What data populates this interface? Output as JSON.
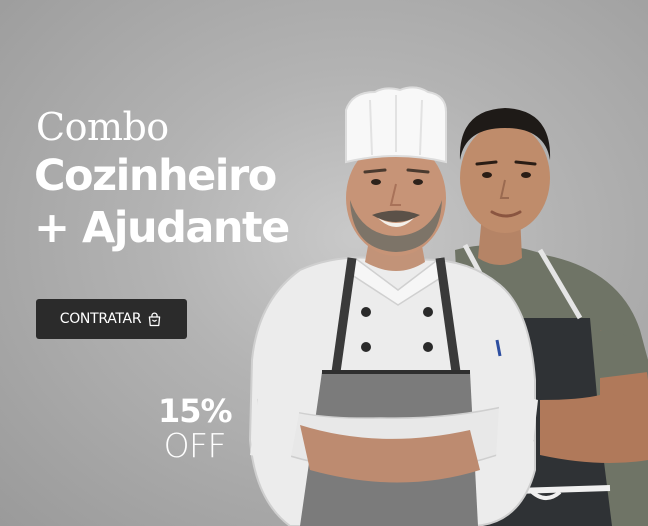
{
  "promo": {
    "line1": "Combo",
    "line2": "Cozinheiro",
    "line3": "+ Ajudante",
    "cta_label": "CONTRATAR",
    "cta_icon": "shopping-bag-icon",
    "discount_value": "15%",
    "discount_label": "OFF"
  },
  "colors": {
    "background": "#b3b3b3",
    "text": "#ffffff",
    "button": "#2b2b2b"
  }
}
